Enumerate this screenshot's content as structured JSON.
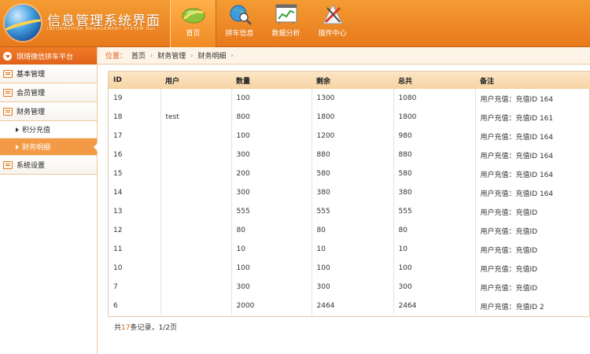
{
  "app": {
    "title": "信息管理系统界面",
    "subtitle": "INFORMATION MANAGEMENT SYSTEM GUI"
  },
  "nav": [
    {
      "label": "首页",
      "icon": "leaf-icon",
      "active": true
    },
    {
      "label": "拼车信息",
      "icon": "globe-search-icon",
      "active": false
    },
    {
      "label": "数据分析",
      "icon": "chart-icon",
      "active": false
    },
    {
      "label": "插件中心",
      "icon": "tools-icon",
      "active": false
    }
  ],
  "sidebar": {
    "header": "琪琦微信拼车平台",
    "groups": [
      {
        "label": "基本管理"
      },
      {
        "label": "会员管理"
      },
      {
        "label": "财务管理",
        "items": [
          {
            "label": "积分充值",
            "active": false
          },
          {
            "label": "财务明细",
            "active": true
          }
        ]
      },
      {
        "label": "系统设置"
      }
    ]
  },
  "breadcrumb": {
    "prefix": "位置：",
    "items": [
      "首页",
      "财务管理",
      "财务明细"
    ]
  },
  "table": {
    "columns": [
      "ID",
      "用户",
      "数量",
      "剩余",
      "总共",
      "备注"
    ],
    "rows": [
      [
        "19",
        "",
        "100",
        "1300",
        "1080",
        "用户充值：充值ID 164"
      ],
      [
        "18",
        "test",
        "800",
        "1800",
        "1800",
        "用户充值：充值ID 161"
      ],
      [
        "17",
        "",
        "100",
        "1200",
        "980",
        "用户充值：充值ID 164"
      ],
      [
        "16",
        "",
        "300",
        "880",
        "880",
        "用户充值：充值ID 164"
      ],
      [
        "15",
        "",
        "200",
        "580",
        "580",
        "用户充值：充值ID 164"
      ],
      [
        "14",
        "",
        "300",
        "380",
        "380",
        "用户充值：充值ID 164"
      ],
      [
        "13",
        "",
        "555",
        "555",
        "555",
        "用户充值：充值ID"
      ],
      [
        "12",
        "",
        "80",
        "80",
        "80",
        "用户充值：充值ID"
      ],
      [
        "11",
        "",
        "10",
        "10",
        "10",
        "用户充值：充值ID"
      ],
      [
        "10",
        "",
        "100",
        "100",
        "100",
        "用户充值：充值ID"
      ],
      [
        "7",
        "",
        "300",
        "300",
        "300",
        "用户充值：充值ID"
      ],
      [
        "6",
        "",
        "2000",
        "2464",
        "2464",
        "用户充值：充值ID 2"
      ]
    ]
  },
  "pager": {
    "prefix": "共",
    "count": "17",
    "suffix": "条记录，1/2页"
  },
  "colors": {
    "accent": "#e0621a",
    "header": "#f08a23",
    "table_head": "#f6d3a3"
  }
}
